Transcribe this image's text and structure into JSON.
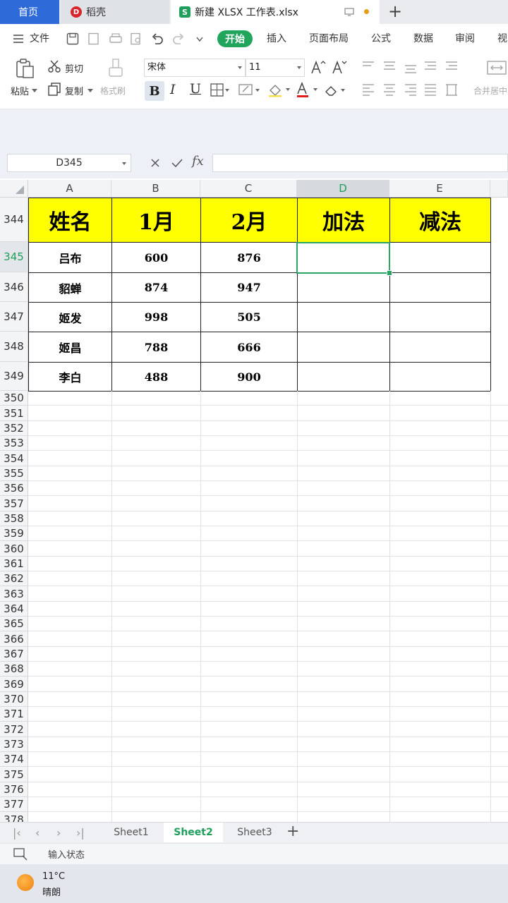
{
  "tabs": {
    "home": "首页",
    "daoke": "稻壳",
    "file": "新建 XLSX 工作表.xlsx",
    "add": "+"
  },
  "menu": {
    "file": "文件",
    "start": "开始",
    "items": [
      "插入",
      "页面布局",
      "公式",
      "数据",
      "审阅",
      "视"
    ]
  },
  "ribbon": {
    "paste": "粘贴",
    "cut": "剪切",
    "copy": "复制",
    "format_painter": "格式刷",
    "font_name": "宋体",
    "font_size": "11",
    "bold": "B",
    "italic": "I",
    "underline": "U",
    "merge_center": "合并居中"
  },
  "formula_bar": {
    "name_box": "D345",
    "fx": "fx",
    "formula": ""
  },
  "sheet": {
    "columns": [
      "A",
      "B",
      "C",
      "D",
      "E"
    ],
    "selected_column": "D",
    "header_row_number": "344",
    "headers": [
      "姓名",
      "1月",
      "2月",
      "加法",
      "减法"
    ],
    "data_rows": [
      {
        "row": "345",
        "name": "吕布",
        "jan": "600",
        "feb": "876",
        "add": "",
        "sub": ""
      },
      {
        "row": "346",
        "name": "貂蝉",
        "jan": "874",
        "feb": "947",
        "add": "",
        "sub": ""
      },
      {
        "row": "347",
        "name": "姬发",
        "jan": "998",
        "feb": "505",
        "add": "",
        "sub": ""
      },
      {
        "row": "348",
        "name": "姬昌",
        "jan": "788",
        "feb": "666",
        "add": "",
        "sub": ""
      },
      {
        "row": "349",
        "name": "李白",
        "jan": "488",
        "feb": "900",
        "add": "",
        "sub": ""
      }
    ],
    "empty_row_numbers": [
      "350",
      "351",
      "352",
      "353",
      "354",
      "355",
      "356",
      "357",
      "358",
      "359",
      "360",
      "361",
      "362",
      "363",
      "364",
      "365",
      "366",
      "367",
      "368",
      "369",
      "370",
      "371",
      "372",
      "373",
      "374",
      "375",
      "376",
      "377",
      "378"
    ],
    "selected_cell": "D345"
  },
  "sheet_tabs": {
    "tabs": [
      "Sheet1",
      "Sheet2",
      "Sheet3"
    ],
    "active": "Sheet2",
    "add": "+"
  },
  "status": {
    "input_state": "输入状态"
  },
  "taskbar": {
    "temperature": "11°C",
    "condition": "晴朗"
  },
  "colors": {
    "accent_green": "#21a45b",
    "header_fill": "#ffff00",
    "home_tab": "#2f6bd8"
  }
}
